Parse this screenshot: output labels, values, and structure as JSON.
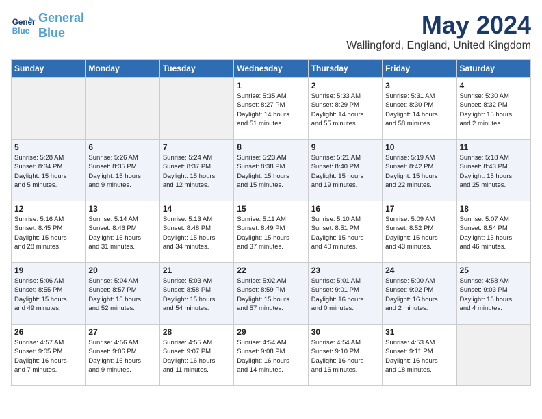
{
  "header": {
    "logo_line1": "General",
    "logo_line2": "Blue",
    "month": "May 2024",
    "location": "Wallingford, England, United Kingdom"
  },
  "weekdays": [
    "Sunday",
    "Monday",
    "Tuesday",
    "Wednesday",
    "Thursday",
    "Friday",
    "Saturday"
  ],
  "weeks": [
    [
      {
        "day": "",
        "info": ""
      },
      {
        "day": "",
        "info": ""
      },
      {
        "day": "",
        "info": ""
      },
      {
        "day": "1",
        "info": "Sunrise: 5:35 AM\nSunset: 8:27 PM\nDaylight: 14 hours\nand 51 minutes."
      },
      {
        "day": "2",
        "info": "Sunrise: 5:33 AM\nSunset: 8:29 PM\nDaylight: 14 hours\nand 55 minutes."
      },
      {
        "day": "3",
        "info": "Sunrise: 5:31 AM\nSunset: 8:30 PM\nDaylight: 14 hours\nand 58 minutes."
      },
      {
        "day": "4",
        "info": "Sunrise: 5:30 AM\nSunset: 8:32 PM\nDaylight: 15 hours\nand 2 minutes."
      }
    ],
    [
      {
        "day": "5",
        "info": "Sunrise: 5:28 AM\nSunset: 8:34 PM\nDaylight: 15 hours\nand 5 minutes."
      },
      {
        "day": "6",
        "info": "Sunrise: 5:26 AM\nSunset: 8:35 PM\nDaylight: 15 hours\nand 9 minutes."
      },
      {
        "day": "7",
        "info": "Sunrise: 5:24 AM\nSunset: 8:37 PM\nDaylight: 15 hours\nand 12 minutes."
      },
      {
        "day": "8",
        "info": "Sunrise: 5:23 AM\nSunset: 8:38 PM\nDaylight: 15 hours\nand 15 minutes."
      },
      {
        "day": "9",
        "info": "Sunrise: 5:21 AM\nSunset: 8:40 PM\nDaylight: 15 hours\nand 19 minutes."
      },
      {
        "day": "10",
        "info": "Sunrise: 5:19 AM\nSunset: 8:42 PM\nDaylight: 15 hours\nand 22 minutes."
      },
      {
        "day": "11",
        "info": "Sunrise: 5:18 AM\nSunset: 8:43 PM\nDaylight: 15 hours\nand 25 minutes."
      }
    ],
    [
      {
        "day": "12",
        "info": "Sunrise: 5:16 AM\nSunset: 8:45 PM\nDaylight: 15 hours\nand 28 minutes."
      },
      {
        "day": "13",
        "info": "Sunrise: 5:14 AM\nSunset: 8:46 PM\nDaylight: 15 hours\nand 31 minutes."
      },
      {
        "day": "14",
        "info": "Sunrise: 5:13 AM\nSunset: 8:48 PM\nDaylight: 15 hours\nand 34 minutes."
      },
      {
        "day": "15",
        "info": "Sunrise: 5:11 AM\nSunset: 8:49 PM\nDaylight: 15 hours\nand 37 minutes."
      },
      {
        "day": "16",
        "info": "Sunrise: 5:10 AM\nSunset: 8:51 PM\nDaylight: 15 hours\nand 40 minutes."
      },
      {
        "day": "17",
        "info": "Sunrise: 5:09 AM\nSunset: 8:52 PM\nDaylight: 15 hours\nand 43 minutes."
      },
      {
        "day": "18",
        "info": "Sunrise: 5:07 AM\nSunset: 8:54 PM\nDaylight: 15 hours\nand 46 minutes."
      }
    ],
    [
      {
        "day": "19",
        "info": "Sunrise: 5:06 AM\nSunset: 8:55 PM\nDaylight: 15 hours\nand 49 minutes."
      },
      {
        "day": "20",
        "info": "Sunrise: 5:04 AM\nSunset: 8:57 PM\nDaylight: 15 hours\nand 52 minutes."
      },
      {
        "day": "21",
        "info": "Sunrise: 5:03 AM\nSunset: 8:58 PM\nDaylight: 15 hours\nand 54 minutes."
      },
      {
        "day": "22",
        "info": "Sunrise: 5:02 AM\nSunset: 8:59 PM\nDaylight: 15 hours\nand 57 minutes."
      },
      {
        "day": "23",
        "info": "Sunrise: 5:01 AM\nSunset: 9:01 PM\nDaylight: 16 hours\nand 0 minutes."
      },
      {
        "day": "24",
        "info": "Sunrise: 5:00 AM\nSunset: 9:02 PM\nDaylight: 16 hours\nand 2 minutes."
      },
      {
        "day": "25",
        "info": "Sunrise: 4:58 AM\nSunset: 9:03 PM\nDaylight: 16 hours\nand 4 minutes."
      }
    ],
    [
      {
        "day": "26",
        "info": "Sunrise: 4:57 AM\nSunset: 9:05 PM\nDaylight: 16 hours\nand 7 minutes."
      },
      {
        "day": "27",
        "info": "Sunrise: 4:56 AM\nSunset: 9:06 PM\nDaylight: 16 hours\nand 9 minutes."
      },
      {
        "day": "28",
        "info": "Sunrise: 4:55 AM\nSunset: 9:07 PM\nDaylight: 16 hours\nand 11 minutes."
      },
      {
        "day": "29",
        "info": "Sunrise: 4:54 AM\nSunset: 9:08 PM\nDaylight: 16 hours\nand 14 minutes."
      },
      {
        "day": "30",
        "info": "Sunrise: 4:54 AM\nSunset: 9:10 PM\nDaylight: 16 hours\nand 16 minutes."
      },
      {
        "day": "31",
        "info": "Sunrise: 4:53 AM\nSunset: 9:11 PM\nDaylight: 16 hours\nand 18 minutes."
      },
      {
        "day": "",
        "info": ""
      }
    ]
  ]
}
